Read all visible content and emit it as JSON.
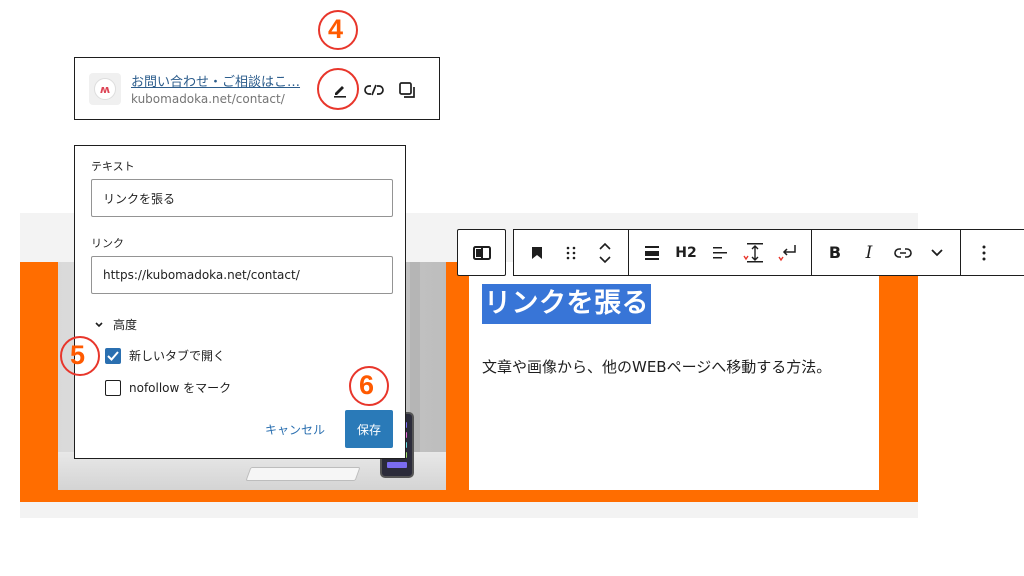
{
  "editor": {
    "heading": "リンクを張る",
    "paragraph": "文章や画像から、他のWEBページへ移動する方法。"
  },
  "link_preview": {
    "title": "お問い合わせ・ご相談はこ…",
    "url": "kubomadoka.net/contact/",
    "favicon_icon": "site-favicon-icon",
    "edit_icon": "pencil-icon",
    "unlink_icon": "unlink-icon",
    "copy_icon": "copy-icon"
  },
  "link_dialog": {
    "text_label": "テキスト",
    "text_value": "リンクを張る",
    "link_label": "リンク",
    "link_value": "https://kubomadoka.net/contact/",
    "advanced_label": "高度",
    "new_tab_label": "新しいタブで開く",
    "new_tab_checked": true,
    "nofollow_label": "nofollow をマーク",
    "nofollow_checked": false,
    "cancel_label": "キャンセル",
    "save_label": "保存"
  },
  "toolbar": {
    "heading_level": "H2",
    "bold": "B",
    "italic": "I",
    "icons": [
      "columns-icon",
      "bookmark-icon",
      "drag-handle-icon",
      "move-up-down-icon",
      "align-icon",
      "text-align-icon",
      "line-height-icon",
      "line-break-icon",
      "link-icon",
      "chevron-down-icon",
      "more-options-icon"
    ]
  },
  "steps": {
    "four": "4",
    "five": "5",
    "six": "6"
  },
  "colors": {
    "accent_orange": "#ff6d00",
    "selection_blue": "#3875d7",
    "primary_blue": "#2a7ab8",
    "marker_red": "#e8362b"
  }
}
